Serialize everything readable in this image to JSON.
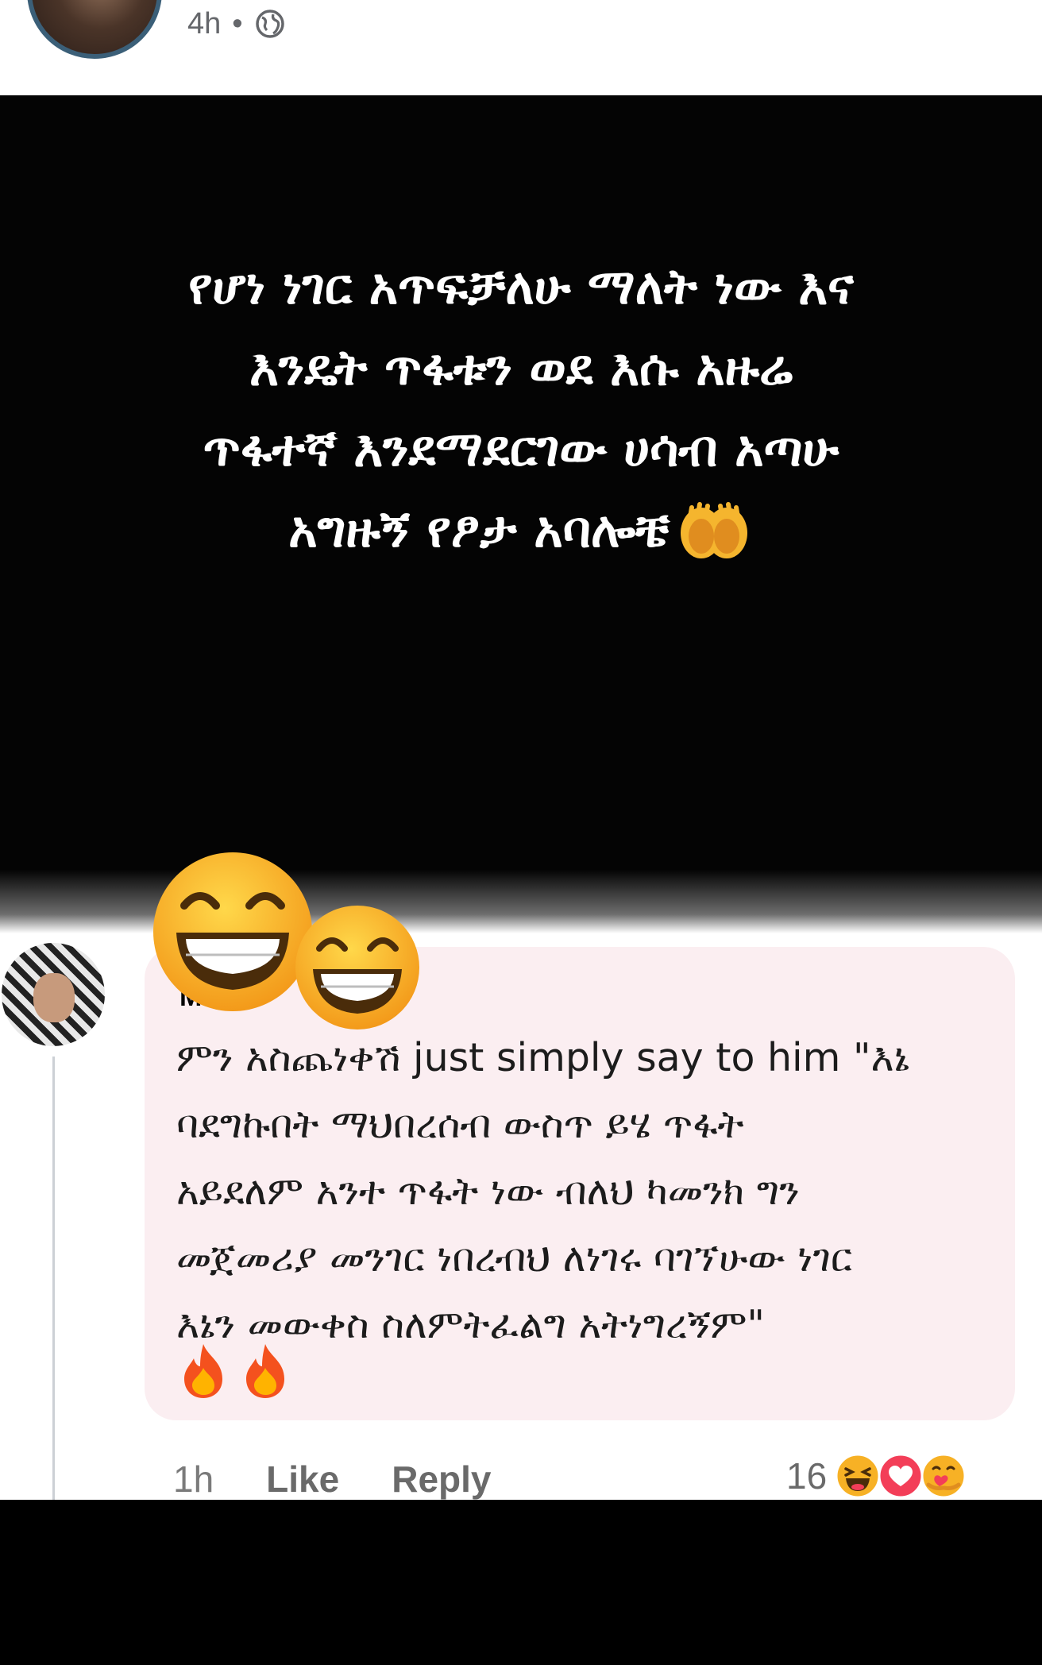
{
  "header": {
    "time": "4h",
    "separator": "•",
    "privacy_icon": "globe-icon"
  },
  "post": {
    "lines": [
      "የሆነ ነገር አጥፍቻለሁ ማለት ነው እና",
      "እንዴት ጥፋቱን ወደ እሱ አዙሬ",
      "ጥፋተኛ እንደማደርገው ሀሳብ አጣሁ",
      "አግዙኝ የፆታ አባሎቼ"
    ],
    "trailing_icon": "praying-hands-icon"
  },
  "comment": {
    "author": "M",
    "lines": [
      "ምን አስጨነቀሽ just simply say to him \"እኔ",
      "ባደግኩበት ማህበረሰብ ውስጥ ይሄ ጥፋት",
      "አይደለም አንተ ጥፋት ነው ብለህ ካመንክ ግን",
      "መጀመሪያ መንገር ነበረብህ ለነገሩ ባገኘሁው ነገር",
      "እኔን መውቀስ ስለምትፈልግ አትነግረኝም\""
    ],
    "emoji_icons": [
      "fire-icon",
      "fire-icon"
    ],
    "stickers": [
      "grinning-face-icon",
      "grinning-face-icon"
    ],
    "time": "1h",
    "like_label": "Like",
    "reply_label": "Reply",
    "reaction_count": "16",
    "reactions": [
      "haha-icon",
      "love-icon",
      "care-icon"
    ]
  },
  "colors": {
    "post_background": "#040404",
    "bubble_background": "#fbeef1",
    "meta_text": "#65676b",
    "love_red": "#f33e58",
    "emoji_yellow": "#f7b125"
  }
}
